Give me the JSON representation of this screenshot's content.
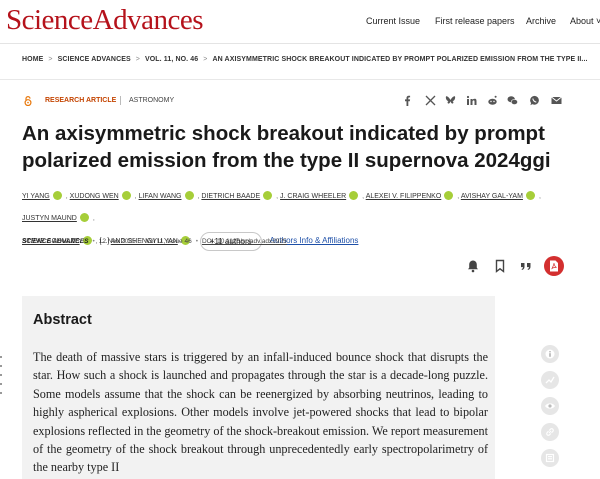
{
  "header": {
    "logo": "ScienceAdvances",
    "nav": [
      "Current Issue",
      "First release papers",
      "Archive",
      "About ˅"
    ]
  },
  "breadcrumb": [
    "HOME",
    "SCIENCE ADVANCES",
    "VOL. 11, NO. 46",
    "AN AXISYMMETRIC SHOCK BREAKOUT INDICATED BY PROMPT POLARIZED EMISSION FROM THE TYPE II..."
  ],
  "article": {
    "type_label": "RESEARCH ARTICLE",
    "section_label": "ASTRONOMY",
    "title": "An axisymmetric shock breakout indicated by prompt polarized emission from the type II supernova 2024ggi",
    "authors": [
      "YI YANG",
      "XUDONG WEN",
      "LIFAN WANG",
      "DIETRICH BAADE",
      "J. CRAIG WHEELER",
      "ALEXEI V. FILIPPENKO",
      "AVISHAY GAL-YAM",
      "JUSTYN MAUND",
      "STEVE SCHULZE",
      "[...]",
      "AND SHENGYU YAN"
    ],
    "more_authors_label": "+11 authors",
    "info_link": "Authors Info & Affiliations",
    "journal": "SCIENCE ADVANCES",
    "date": "12 Nov 2025",
    "volume_issue": "Vol 11, Issue 46",
    "doi": "DOI: 10.1126/sciadv.adx2925"
  },
  "share_icons": [
    "facebook-icon",
    "x-icon",
    "bluesky-icon",
    "linkedin-icon",
    "reddit-icon",
    "wechat-icon",
    "whatsapp-icon",
    "email-icon"
  ],
  "action_icons": [
    "alert-bell-icon",
    "bookmark-icon",
    "cite-icon",
    "pdf-icon"
  ],
  "abstract": {
    "heading": "Abstract",
    "text": "The death of massive stars is triggered by an infall-induced bounce shock that disrupts the star. How such a shock is launched and propagates through the star is a decade-long puzzle. Some models assume that the shock can be reenergized by absorbing neutrinos, leading to highly aspherical explosions. Other models involve jet-powered shocks that lead to bipolar explosions reflected in the geometry of the shock-breakout emission. We report measurement of the geometry of the shock breakout through unprecedentedly early spectropolarimetry of the nearby type II"
  },
  "side_tools": [
    "info-icon",
    "metrics-icon",
    "views-icon",
    "share-link-icon",
    "media-icon"
  ],
  "colors": {
    "brand": "#b5121b",
    "article_type": "#c44400",
    "orcid": "#a6ce39",
    "link": "#1d4fa8",
    "pdf": "#d32f2f",
    "abstract_bg": "#f2f2f2"
  }
}
